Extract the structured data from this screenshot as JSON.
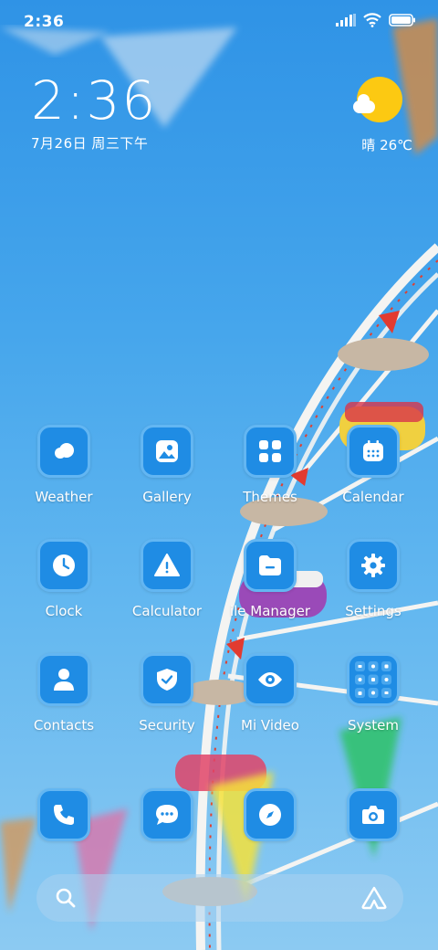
{
  "status_bar": {
    "time": "2:36",
    "icons": [
      "signal-icon",
      "wifi-icon",
      "battery-icon"
    ]
  },
  "clock_widget": {
    "time": "2:36",
    "date": "7月26日 周三下午"
  },
  "weather_widget": {
    "icon": "sunny-partly-cloudy-icon",
    "text": "晴 26℃"
  },
  "colors": {
    "icon_background": "#1f8ce4",
    "icon_border": "#63b6f2",
    "sun": "#fcc912"
  },
  "apps": [
    {
      "label": "Weather",
      "icon": "weather-icon"
    },
    {
      "label": "Gallery",
      "icon": "gallery-icon"
    },
    {
      "label": "Themes",
      "icon": "themes-icon"
    },
    {
      "label": "Calendar",
      "icon": "calendar-icon"
    },
    {
      "label": "Clock",
      "icon": "clock-icon"
    },
    {
      "label": "Calculator",
      "icon": "calculator-icon"
    },
    {
      "label": "ile Manager",
      "icon": "file-manager-icon"
    },
    {
      "label": "Settings",
      "icon": "settings-icon"
    },
    {
      "label": "Contacts",
      "icon": "contacts-icon"
    },
    {
      "label": "Security",
      "icon": "security-icon"
    },
    {
      "label": "Mi Video",
      "icon": "mi-video-icon"
    },
    {
      "label": "System",
      "icon": "system-folder-icon"
    }
  ],
  "dock": [
    {
      "icon": "phone-icon"
    },
    {
      "icon": "messages-icon"
    },
    {
      "icon": "browser-icon"
    },
    {
      "icon": "camera-icon"
    }
  ],
  "search_bar": {
    "icons": [
      "search-icon",
      "assistant-icon"
    ]
  }
}
